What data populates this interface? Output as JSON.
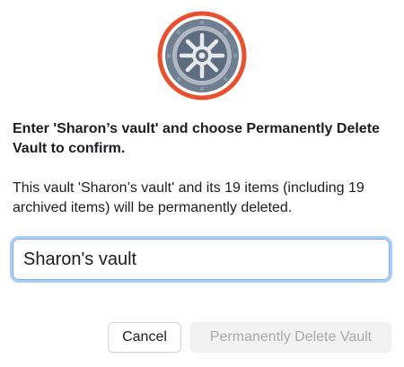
{
  "dialog": {
    "heading": "Enter 'Sharon’s vault' and choose Permanently Delete Vault to confirm.",
    "message": "This vault 'Sharon’s vault' and its 19 items (including 19 archived items) will be permanently deleted.",
    "input": {
      "value": "Sharon's vault"
    },
    "buttons": {
      "cancel": "Cancel",
      "delete": "Permanently Delete Vault"
    }
  },
  "icons": {
    "vault": "vault-icon"
  },
  "colors": {
    "vault_ring": "#e8502f",
    "input_focus": "#a9cdf6",
    "disabled_text": "#a8a8a8"
  }
}
